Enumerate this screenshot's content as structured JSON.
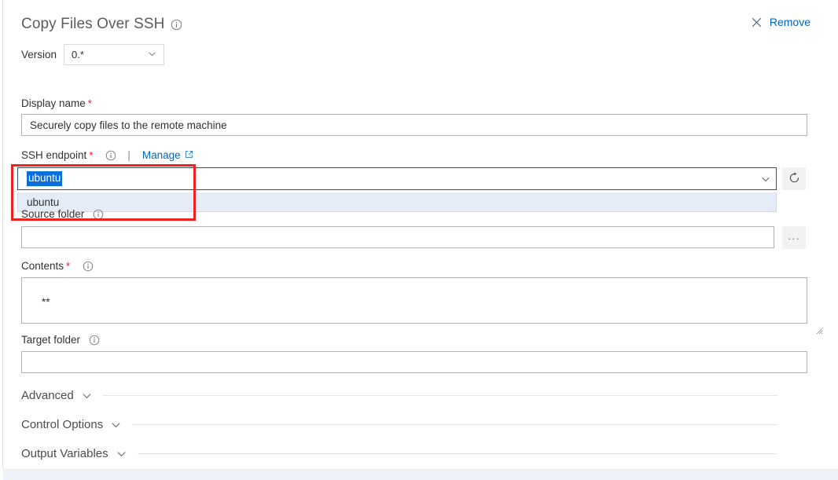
{
  "header": {
    "title": "Copy Files Over SSH",
    "info_icon": "info-circle-icon",
    "remove_label": "Remove",
    "remove_icon": "close-x-icon"
  },
  "version": {
    "label": "Version",
    "value": "0.*",
    "chevron_icon": "chevron-down-icon"
  },
  "fields": {
    "display_name": {
      "label": "Display name",
      "required": "*",
      "value": "Securely copy files to the remote machine",
      "placeholder": ""
    },
    "ssh_endpoint": {
      "label": "SSH endpoint",
      "required": "*",
      "info_icon": "info-circle-icon",
      "separator": "|",
      "manage_label": "Manage",
      "manage_icon": "external-link-icon",
      "value": "ubuntu",
      "value_selected": true,
      "chevron_icon": "chevron-down-icon",
      "refresh_icon": "refresh-circular-arrow-icon",
      "options": [
        "ubuntu"
      ]
    },
    "source_folder": {
      "label": "Source folder",
      "info_icon": "info-circle-icon",
      "value": "",
      "browse_label": "...",
      "browse_icon": "ellipsis-icon"
    },
    "contents": {
      "label": "Contents",
      "required": "*",
      "info_icon": "info-circle-icon",
      "value": "**"
    },
    "target_folder": {
      "label": "Target folder",
      "info_icon": "info-circle-icon",
      "value": ""
    }
  },
  "sections": [
    {
      "label": "Advanced",
      "chevron_icon": "chevron-down-icon",
      "expanded": false
    },
    {
      "label": "Control Options",
      "chevron_icon": "chevron-down-icon",
      "expanded": false
    },
    {
      "label": "Output Variables",
      "chevron_icon": "chevron-down-icon",
      "expanded": false
    }
  ],
  "colors": {
    "link": "#0066bf",
    "required_star": "#e81123",
    "selection_highlight": "#0b6ed9",
    "annotation_box": "#ee2222",
    "dropdown_item_bg": "#e4edf7",
    "focus_border": "#27566e"
  }
}
